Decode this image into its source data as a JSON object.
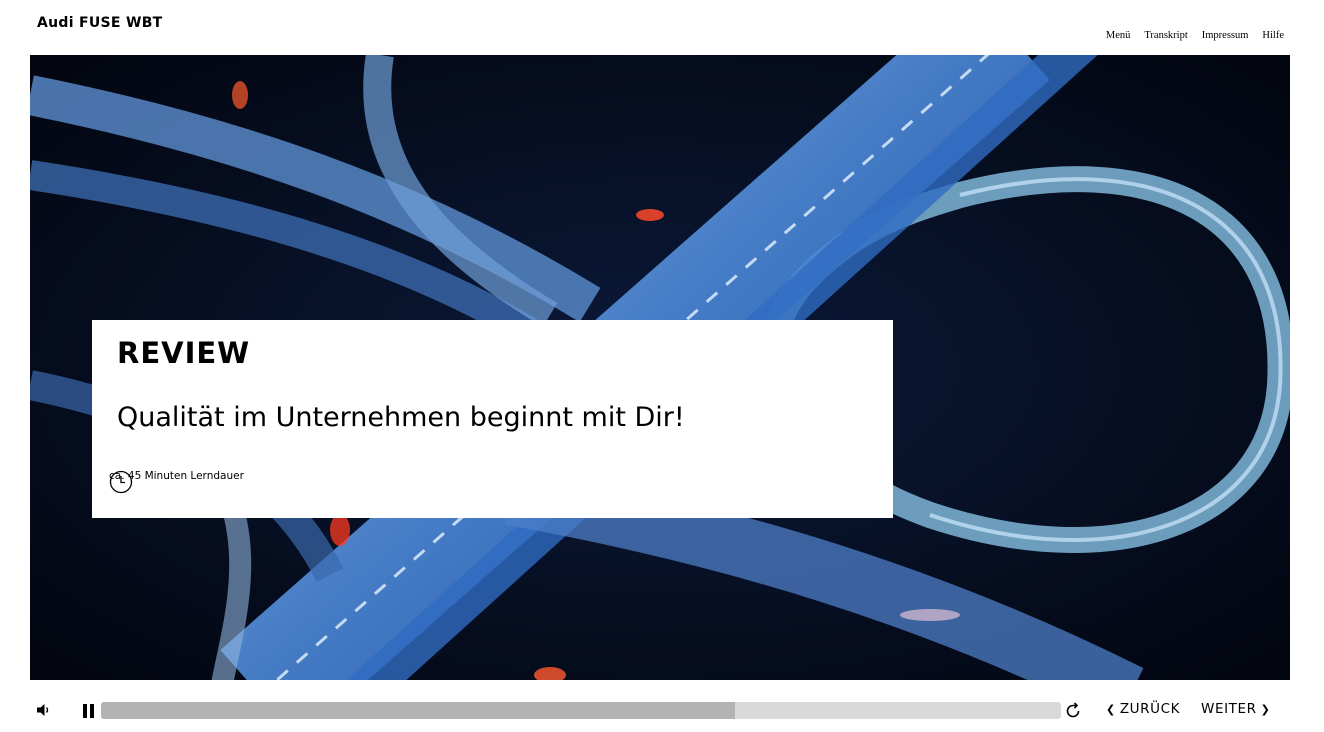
{
  "app": {
    "title": "Audi FUSE WBT"
  },
  "topnav": {
    "items": [
      "Menü",
      "Transkript",
      "Impressum",
      "Hilfe"
    ]
  },
  "card": {
    "kicker": "REVIEW",
    "headline": "Qualität im Unternehmen beginnt mit Dir!",
    "duration": "ca. 45 Minuten Lerndauer"
  },
  "player": {
    "progress_percent": 66,
    "back_label": "ZURÜCK",
    "next_label": "WEITER"
  },
  "icons": {
    "volume": "speaker-icon",
    "pause": "pause-icon",
    "replay": "replay-icon",
    "clock": "clock-icon",
    "back": "chevron-left-icon",
    "next": "chevron-right-icon"
  }
}
